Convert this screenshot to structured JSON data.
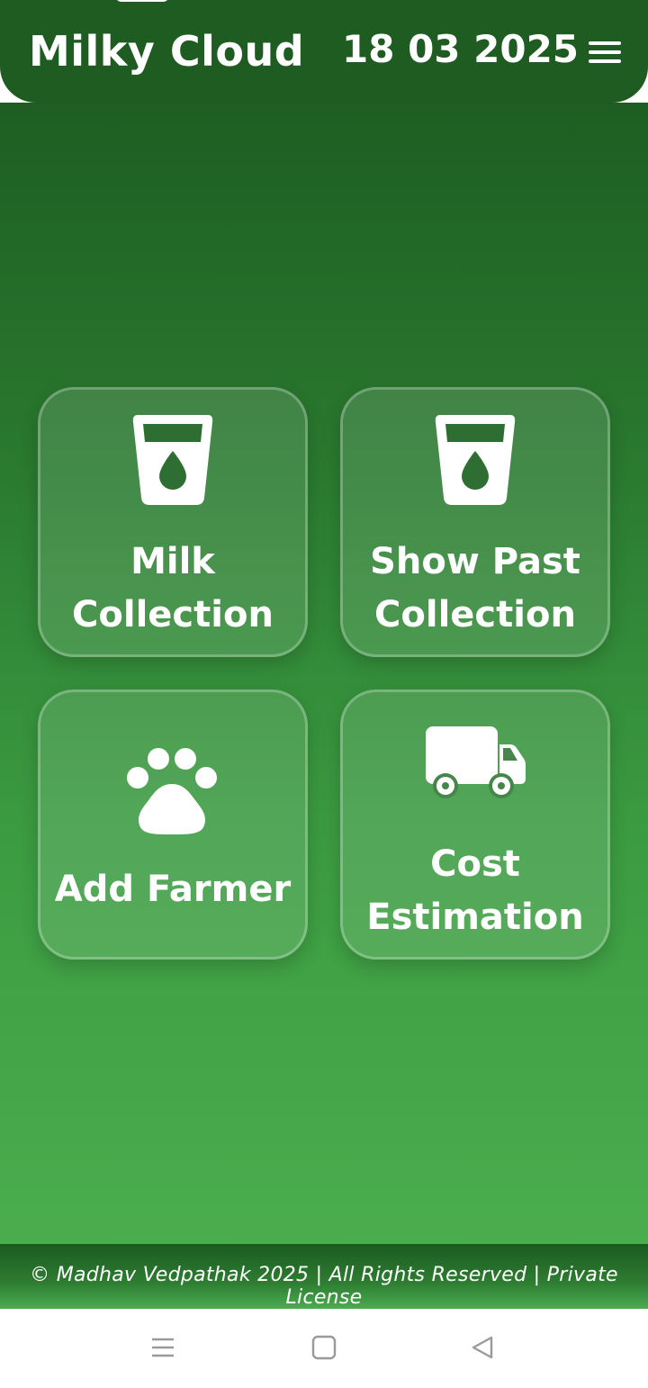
{
  "header": {
    "title": "Milky Cloud",
    "date": "18 03 2025",
    "menu_icon": "hamburger-menu-icon"
  },
  "cards": [
    {
      "label_line1": "Milk",
      "label_line2": "Collection",
      "icon": "milk-cup-icon"
    },
    {
      "label_line1": "Show Past",
      "label_line2": "Collection",
      "icon": "milk-cup-icon"
    },
    {
      "label": "Add Farmer",
      "icon": "paw-icon"
    },
    {
      "label_line1": "Cost",
      "label_line2": "Estimation",
      "icon": "truck-icon"
    }
  ],
  "footer": {
    "text": "© Madhav Vedpathak 2025 | All Rights Reserved | Private License"
  },
  "colors": {
    "header_bg": "#1e5c22",
    "gradient_bottom": "#4aad4e",
    "card_border": "rgba(255,255,255,0.25)",
    "text": "#ffffff"
  },
  "system_nav": {
    "recent_icon": "recent-apps-icon",
    "home_icon": "home-icon",
    "back_icon": "back-icon"
  }
}
